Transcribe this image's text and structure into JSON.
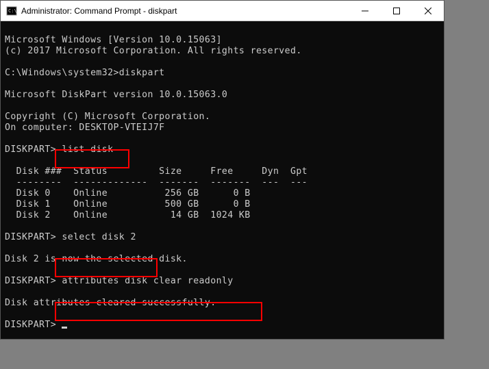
{
  "window": {
    "title": "Administrator: Command Prompt - diskpart"
  },
  "lines": {
    "l0": "Microsoft Windows [Version 10.0.15063]",
    "l1": "(c) 2017 Microsoft Corporation. All rights reserved.",
    "l2": "",
    "l3": "C:\\Windows\\system32>diskpart",
    "l4": "",
    "l5": "Microsoft DiskPart version 10.0.15063.0",
    "l6": "",
    "l7": "Copyright (C) Microsoft Corporation.",
    "l8": "On computer: DESKTOP-VTEIJ7F",
    "l9": "",
    "p1p": "DISKPART> ",
    "p1c": "list disk",
    "l11": "",
    "l12": "  Disk ###  Status         Size     Free     Dyn  Gpt",
    "l13": "  --------  -------------  -------  -------  ---  ---",
    "l14": "  Disk 0    Online          256 GB      0 B",
    "l15": "  Disk 1    Online          500 GB      0 B",
    "l16": "  Disk 2    Online           14 GB  1024 KB",
    "l17": "",
    "p2p": "DISKPART> ",
    "p2c": "select disk 2",
    "l19": "",
    "l20": "Disk 2 is now the selected disk.",
    "l21": "",
    "p3p": "DISKPART> ",
    "p3c": "attributes disk clear readonly",
    "l23": "",
    "l24": "Disk attributes cleared successfully.",
    "l25": "",
    "p4p": "DISKPART> "
  },
  "chart_data": {
    "type": "table",
    "title": "list disk",
    "columns": [
      "Disk ###",
      "Status",
      "Size",
      "Free",
      "Dyn",
      "Gpt"
    ],
    "rows": [
      {
        "Disk ###": "Disk 0",
        "Status": "Online",
        "Size": "256 GB",
        "Free": "0 B",
        "Dyn": "",
        "Gpt": ""
      },
      {
        "Disk ###": "Disk 1",
        "Status": "Online",
        "Size": "500 GB",
        "Free": "0 B",
        "Dyn": "",
        "Gpt": ""
      },
      {
        "Disk ###": "Disk 2",
        "Status": "Online",
        "Size": "14 GB",
        "Free": "1024 KB",
        "Dyn": "",
        "Gpt": ""
      }
    ]
  }
}
